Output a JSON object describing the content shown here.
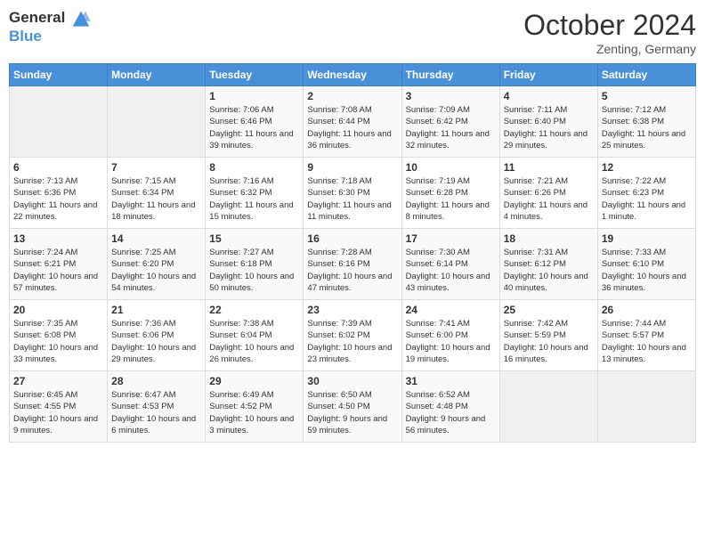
{
  "header": {
    "logo_line1": "General",
    "logo_line2": "Blue",
    "month_title": "October 2024",
    "location": "Zenting, Germany"
  },
  "weekdays": [
    "Sunday",
    "Monday",
    "Tuesday",
    "Wednesday",
    "Thursday",
    "Friday",
    "Saturday"
  ],
  "days": [
    {
      "date": "",
      "sunrise": "",
      "sunset": "",
      "daylight": ""
    },
    {
      "date": "",
      "sunrise": "",
      "sunset": "",
      "daylight": ""
    },
    {
      "date": "1",
      "sunrise": "Sunrise: 7:06 AM",
      "sunset": "Sunset: 6:46 PM",
      "daylight": "Daylight: 11 hours and 39 minutes."
    },
    {
      "date": "2",
      "sunrise": "Sunrise: 7:08 AM",
      "sunset": "Sunset: 6:44 PM",
      "daylight": "Daylight: 11 hours and 36 minutes."
    },
    {
      "date": "3",
      "sunrise": "Sunrise: 7:09 AM",
      "sunset": "Sunset: 6:42 PM",
      "daylight": "Daylight: 11 hours and 32 minutes."
    },
    {
      "date": "4",
      "sunrise": "Sunrise: 7:11 AM",
      "sunset": "Sunset: 6:40 PM",
      "daylight": "Daylight: 11 hours and 29 minutes."
    },
    {
      "date": "5",
      "sunrise": "Sunrise: 7:12 AM",
      "sunset": "Sunset: 6:38 PM",
      "daylight": "Daylight: 11 hours and 25 minutes."
    },
    {
      "date": "6",
      "sunrise": "Sunrise: 7:13 AM",
      "sunset": "Sunset: 6:36 PM",
      "daylight": "Daylight: 11 hours and 22 minutes."
    },
    {
      "date": "7",
      "sunrise": "Sunrise: 7:15 AM",
      "sunset": "Sunset: 6:34 PM",
      "daylight": "Daylight: 11 hours and 18 minutes."
    },
    {
      "date": "8",
      "sunrise": "Sunrise: 7:16 AM",
      "sunset": "Sunset: 6:32 PM",
      "daylight": "Daylight: 11 hours and 15 minutes."
    },
    {
      "date": "9",
      "sunrise": "Sunrise: 7:18 AM",
      "sunset": "Sunset: 6:30 PM",
      "daylight": "Daylight: 11 hours and 11 minutes."
    },
    {
      "date": "10",
      "sunrise": "Sunrise: 7:19 AM",
      "sunset": "Sunset: 6:28 PM",
      "daylight": "Daylight: 11 hours and 8 minutes."
    },
    {
      "date": "11",
      "sunrise": "Sunrise: 7:21 AM",
      "sunset": "Sunset: 6:26 PM",
      "daylight": "Daylight: 11 hours and 4 minutes."
    },
    {
      "date": "12",
      "sunrise": "Sunrise: 7:22 AM",
      "sunset": "Sunset: 6:23 PM",
      "daylight": "Daylight: 11 hours and 1 minute."
    },
    {
      "date": "13",
      "sunrise": "Sunrise: 7:24 AM",
      "sunset": "Sunset: 6:21 PM",
      "daylight": "Daylight: 10 hours and 57 minutes."
    },
    {
      "date": "14",
      "sunrise": "Sunrise: 7:25 AM",
      "sunset": "Sunset: 6:20 PM",
      "daylight": "Daylight: 10 hours and 54 minutes."
    },
    {
      "date": "15",
      "sunrise": "Sunrise: 7:27 AM",
      "sunset": "Sunset: 6:18 PM",
      "daylight": "Daylight: 10 hours and 50 minutes."
    },
    {
      "date": "16",
      "sunrise": "Sunrise: 7:28 AM",
      "sunset": "Sunset: 6:16 PM",
      "daylight": "Daylight: 10 hours and 47 minutes."
    },
    {
      "date": "17",
      "sunrise": "Sunrise: 7:30 AM",
      "sunset": "Sunset: 6:14 PM",
      "daylight": "Daylight: 10 hours and 43 minutes."
    },
    {
      "date": "18",
      "sunrise": "Sunrise: 7:31 AM",
      "sunset": "Sunset: 6:12 PM",
      "daylight": "Daylight: 10 hours and 40 minutes."
    },
    {
      "date": "19",
      "sunrise": "Sunrise: 7:33 AM",
      "sunset": "Sunset: 6:10 PM",
      "daylight": "Daylight: 10 hours and 36 minutes."
    },
    {
      "date": "20",
      "sunrise": "Sunrise: 7:35 AM",
      "sunset": "Sunset: 6:08 PM",
      "daylight": "Daylight: 10 hours and 33 minutes."
    },
    {
      "date": "21",
      "sunrise": "Sunrise: 7:36 AM",
      "sunset": "Sunset: 6:06 PM",
      "daylight": "Daylight: 10 hours and 29 minutes."
    },
    {
      "date": "22",
      "sunrise": "Sunrise: 7:38 AM",
      "sunset": "Sunset: 6:04 PM",
      "daylight": "Daylight: 10 hours and 26 minutes."
    },
    {
      "date": "23",
      "sunrise": "Sunrise: 7:39 AM",
      "sunset": "Sunset: 6:02 PM",
      "daylight": "Daylight: 10 hours and 23 minutes."
    },
    {
      "date": "24",
      "sunrise": "Sunrise: 7:41 AM",
      "sunset": "Sunset: 6:00 PM",
      "daylight": "Daylight: 10 hours and 19 minutes."
    },
    {
      "date": "25",
      "sunrise": "Sunrise: 7:42 AM",
      "sunset": "Sunset: 5:59 PM",
      "daylight": "Daylight: 10 hours and 16 minutes."
    },
    {
      "date": "26",
      "sunrise": "Sunrise: 7:44 AM",
      "sunset": "Sunset: 5:57 PM",
      "daylight": "Daylight: 10 hours and 13 minutes."
    },
    {
      "date": "27",
      "sunrise": "Sunrise: 6:45 AM",
      "sunset": "Sunset: 4:55 PM",
      "daylight": "Daylight: 10 hours and 9 minutes."
    },
    {
      "date": "28",
      "sunrise": "Sunrise: 6:47 AM",
      "sunset": "Sunset: 4:53 PM",
      "daylight": "Daylight: 10 hours and 6 minutes."
    },
    {
      "date": "29",
      "sunrise": "Sunrise: 6:49 AM",
      "sunset": "Sunset: 4:52 PM",
      "daylight": "Daylight: 10 hours and 3 minutes."
    },
    {
      "date": "30",
      "sunrise": "Sunrise: 6:50 AM",
      "sunset": "Sunset: 4:50 PM",
      "daylight": "Daylight: 9 hours and 59 minutes."
    },
    {
      "date": "31",
      "sunrise": "Sunrise: 6:52 AM",
      "sunset": "Sunset: 4:48 PM",
      "daylight": "Daylight: 9 hours and 56 minutes."
    },
    {
      "date": "",
      "sunrise": "",
      "sunset": "",
      "daylight": ""
    },
    {
      "date": "",
      "sunrise": "",
      "sunset": "",
      "daylight": ""
    }
  ]
}
